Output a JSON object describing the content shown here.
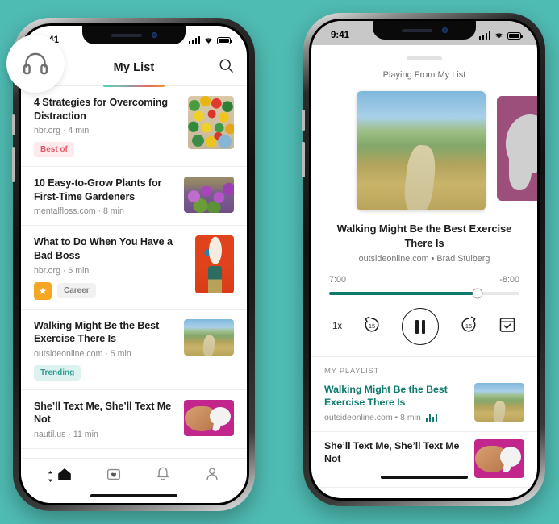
{
  "theme": {
    "background": "#4fbcb3",
    "accent_teal": "#0f7a6c",
    "tag_bestof": "#e8566b",
    "tag_trending": "#2f9e91",
    "star_badge": "#f5a623"
  },
  "left_phone": {
    "status": {
      "time": "9:41",
      "signal_icon": "cellular-bars-icon",
      "wifi_icon": "wifi-icon",
      "battery_icon": "battery-icon"
    },
    "badge_icon": "headphones-icon",
    "header": {
      "title": "My List",
      "search_icon": "search-icon"
    },
    "list": [
      {
        "title": "4 Strategies for Overcoming Distraction",
        "source": "hbr.org",
        "duration": "4 min",
        "meta": "hbr.org · 4 min",
        "tags": [
          {
            "label": "Best of",
            "style": "bestof"
          }
        ],
        "star": false,
        "thumb": "ball-pit-image",
        "thumb_class": "art-balls",
        "thumb_w": 57,
        "thumb_h": 66
      },
      {
        "title": "10 Easy-to-Grow Plants for First-Time Gardeners",
        "source": "mentalfloss.com",
        "duration": "8 min",
        "meta": "mentalfloss.com · 8 min",
        "tags": [],
        "star": false,
        "thumb": "purple-flowers-image",
        "thumb_class": "art-flowers",
        "thumb_w": 62,
        "thumb_h": 45
      },
      {
        "title": "What to Do When You Have a Bad Boss",
        "source": "hbr.org",
        "duration": "6 min",
        "meta": "hbr.org · 6 min",
        "tags": [
          {
            "label": "Career",
            "style": "career"
          }
        ],
        "star": true,
        "thumb": "baseball-head-character-image",
        "thumb_class": "art-boss",
        "thumb_w": 48,
        "thumb_h": 72
      },
      {
        "title": "Walking Might Be the Best Exercise There Is",
        "source": "outsideonline.com",
        "duration": "5 min",
        "meta": "outsideonline.com · 5 min",
        "tags": [
          {
            "label": "Trending",
            "style": "trending"
          }
        ],
        "star": false,
        "thumb": "hiking-trail-image",
        "thumb_class": "art-trail",
        "thumb_w": 62,
        "thumb_h": 45
      },
      {
        "title": "She’ll Text Me, She’ll Text Me Not",
        "source": "nautil.us",
        "duration": "11 min",
        "meta": "nautil.us · 11 min",
        "tags": [],
        "star": false,
        "thumb": "hand-speech-bubble-image",
        "thumb_class": "art-text",
        "thumb_w": 62,
        "thumb_h": 45
      }
    ],
    "tabbar": [
      {
        "name": "home",
        "icon": "home-icon",
        "active": true
      },
      {
        "name": "saved",
        "icon": "heart-square-icon",
        "active": false
      },
      {
        "name": "notifications",
        "icon": "bell-icon",
        "active": false
      },
      {
        "name": "profile",
        "icon": "person-icon",
        "active": false
      }
    ]
  },
  "right_phone": {
    "status": {
      "time": "9:41",
      "signal_icon": "cellular-bars-icon",
      "wifi_icon": "wifi-icon",
      "battery_icon": "battery-icon"
    },
    "sheet_grabber": "drag-handle",
    "playing_from": "Playing From My List",
    "hero": {
      "image": "hiking-trail-image",
      "next_image": "hand-speech-bubble-image"
    },
    "now_playing": {
      "title": "Walking Might Be the Best Exercise There Is",
      "source": "outsideonline.com",
      "author": "Brad Stulberg",
      "subtitle": "outsideonline.com • Brad Stulberg",
      "elapsed": "7:00",
      "remaining": "-8:00",
      "progress_percent": 78
    },
    "controls": {
      "speed_label": "1x",
      "rewind_icon": "rewind-15-icon",
      "rewind_label": "15",
      "play_pause_icon": "pause-icon",
      "forward_icon": "forward-15-icon",
      "forward_label": "15",
      "archive_icon": "archive-check-icon"
    },
    "playlist": {
      "label": "MY PLAYLIST",
      "items": [
        {
          "title": "Walking Might Be the Best Exercise There Is",
          "meta": "outsideonline.com • 8 min",
          "playing": true,
          "eq_icon": "equalizer-icon",
          "thumb": "hiking-trail-image",
          "thumb_class": "art-trail"
        },
        {
          "title": "She’ll Text Me, She’ll Text Me Not",
          "meta": "",
          "playing": false,
          "thumb": "hand-speech-bubble-image",
          "thumb_class": "art-text"
        }
      ]
    }
  }
}
